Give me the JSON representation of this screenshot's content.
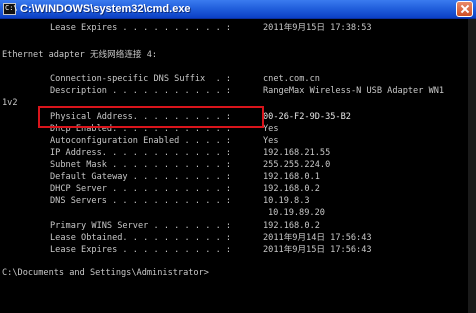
{
  "window": {
    "title": "C:\\WINDOWS\\system32\\cmd.exe",
    "app_icon_text": "C:\\"
  },
  "console": {
    "lease_expires_top": {
      "key": "Lease Expires . . . . . . . . . . :",
      "value": "2011年9月15日 17:38:53"
    },
    "adapter_header": "Ethernet adapter 无线网络连接 4:",
    "dns_suffix": {
      "key": "Connection-specific DNS Suffix  . :",
      "value": "cnet.com.cn"
    },
    "description": {
      "key": "Description . . . . . . . . . . . :",
      "value": "RangeMax Wireless-N USB Adapter WN1"
    },
    "side_fragment": "1v2",
    "physical_address": {
      "key": "Physical Address. . . . . . . . . :",
      "value": "00-26-F2-9D-35-B2"
    },
    "dhcp_enabled": {
      "key": "Dhcp Enabled. . . . . . . . . . . :",
      "value": "Yes"
    },
    "autoconfig": {
      "key": "Autoconfiguration Enabled . . . . :",
      "value": "Yes"
    },
    "ip_address": {
      "key": "IP Address. . . . . . . . . . . . :",
      "value": "192.168.21.55"
    },
    "subnet_mask": {
      "key": "Subnet Mask . . . . . . . . . . . :",
      "value": "255.255.224.0"
    },
    "default_gateway": {
      "key": "Default Gateway . . . . . . . . . :",
      "value": "192.168.0.1"
    },
    "dhcp_server": {
      "key": "DHCP Server . . . . . . . . . . . :",
      "value": "192.168.0.2"
    },
    "dns_servers": {
      "key": "DNS Servers . . . . . . . . . . . :",
      "value": "10.19.8.3",
      "value2": "10.19.89.20"
    },
    "primary_wins": {
      "key": "Primary WINS Server . . . . . . . :",
      "value": "192.168.0.2"
    },
    "lease_obtained": {
      "key": "Lease Obtained. . . . . . . . . . :",
      "value": "2011年9月14日 17:56:43"
    },
    "lease_expires": {
      "key": "Lease Expires . . . . . . . . . . :",
      "value": "2011年9月15日 17:56:43"
    },
    "prompt": "C:\\Documents and Settings\\Administrator>"
  },
  "colors": {
    "console_text": "#c8c8c8",
    "console_bg": "#000000",
    "titlebar": "#2260dd",
    "highlight": "#d9141b"
  },
  "icons": [
    "cmd-app-icon",
    "close-icon"
  ]
}
